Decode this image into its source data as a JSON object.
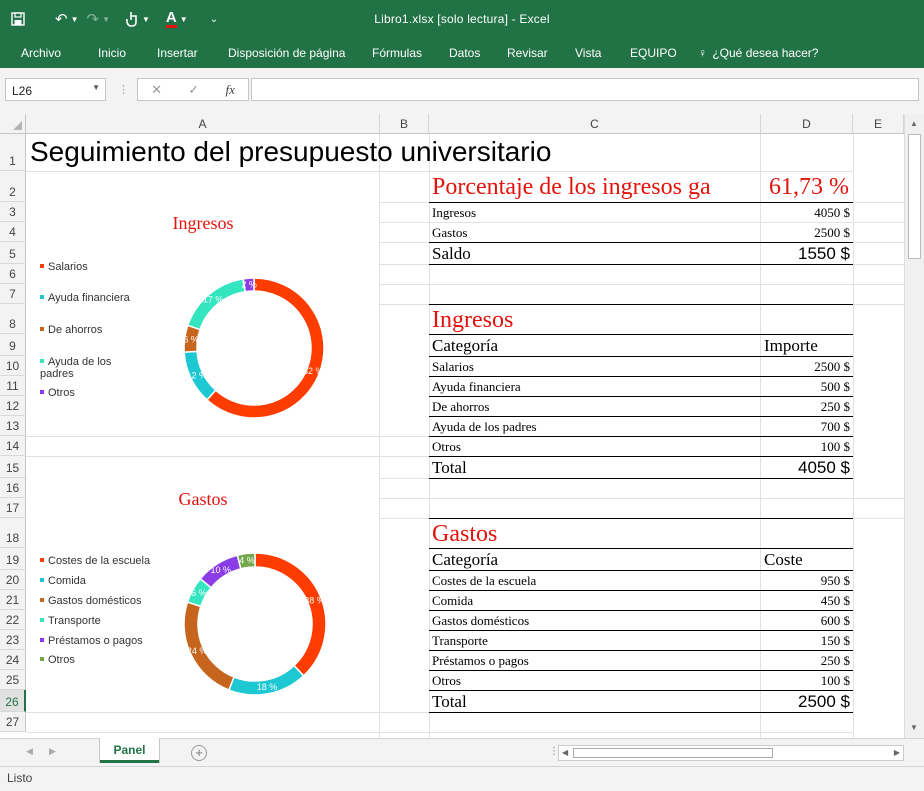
{
  "window": {
    "title": "Libro1.xlsx [solo lectura] - Excel"
  },
  "ribbon": {
    "tabs": [
      "Archivo",
      "Inicio",
      "Insertar",
      "Disposición de página",
      "Fórmulas",
      "Datos",
      "Revisar",
      "Vista",
      "EQUIPO",
      "¿Qué desea hacer?"
    ]
  },
  "formula_bar": {
    "name_box": "L26",
    "fx_label": "fx",
    "formula": ""
  },
  "grid": {
    "columns": [
      "A",
      "B",
      "C",
      "D",
      "E"
    ],
    "rows": [
      "1",
      "2",
      "3",
      "4",
      "5",
      "6",
      "7",
      "8",
      "9",
      "10",
      "11",
      "12",
      "13",
      "14",
      "15",
      "16",
      "17",
      "18",
      "19",
      "20",
      "21",
      "22",
      "23",
      "24",
      "25",
      "26",
      "27"
    ],
    "selected_row": "26"
  },
  "sheet": {
    "title": "Seguimiento del presupuesto universitario",
    "summary": {
      "pct_label": "Porcentaje de los ingresos ga",
      "pct_value": "61,73 %",
      "rows": [
        {
          "label": "Ingresos",
          "value": "4050 $"
        },
        {
          "label": "Gastos",
          "value": "2500 $"
        }
      ],
      "saldo_label": "Saldo",
      "saldo_value": "1550 $"
    },
    "ingresos": {
      "heading": "Ingresos",
      "col_category": "Categoría",
      "col_amount": "Importe",
      "rows": [
        {
          "label": "Salarios",
          "value": "2500 $"
        },
        {
          "label": "Ayuda financiera",
          "value": "500 $"
        },
        {
          "label": "De ahorros",
          "value": "250 $"
        },
        {
          "label": "Ayuda de los padres",
          "value": "700 $"
        },
        {
          "label": "Otros",
          "value": "100 $"
        }
      ],
      "total_label": "Total",
      "total_value": "4050 $"
    },
    "gastos": {
      "heading": "Gastos",
      "col_category": "Categoría",
      "col_amount": "Coste",
      "rows": [
        {
          "label": "Costes de la escuela",
          "value": "950 $"
        },
        {
          "label": "Comida",
          "value": "450 $"
        },
        {
          "label": "Gastos domésticos",
          "value": "600 $"
        },
        {
          "label": "Transporte",
          "value": "150 $"
        },
        {
          "label": "Préstamos o pagos",
          "value": "250 $"
        },
        {
          "label": "Otros",
          "value": "100 $"
        }
      ],
      "total_label": "Total",
      "total_value": "2500 $"
    }
  },
  "chart_data": [
    {
      "type": "pie",
      "title": "Ingresos",
      "categories": [
        "Salarios",
        "Ayuda financiera",
        "De ahorros",
        "Ayuda de los padres",
        "Otros"
      ],
      "values": [
        2500,
        500,
        250,
        700,
        100
      ],
      "labels": [
        "62 %",
        "12 %",
        "6 %",
        "17 %",
        "2 %"
      ],
      "colors": [
        "#ff3c00",
        "#1ec8d2",
        "#c6661e",
        "#33e6c0",
        "#8a3ce6"
      ],
      "donut": true,
      "legend": "left"
    },
    {
      "type": "pie",
      "title": "Gastos",
      "categories": [
        "Costes de la escuela",
        "Comida",
        "Gastos domésticos",
        "Transporte",
        "Préstamos o pagos",
        "Otros"
      ],
      "values": [
        950,
        450,
        600,
        150,
        250,
        100
      ],
      "labels": [
        "38 %",
        "18 %",
        "24 %",
        "6 %",
        "10 %",
        "4 %"
      ],
      "colors": [
        "#ff3c00",
        "#1ec8d2",
        "#c6661e",
        "#33e6c0",
        "#8a3ce6",
        "#72a84a"
      ],
      "donut": true,
      "legend": "left"
    }
  ],
  "sheet_tabs": {
    "active": "Panel"
  },
  "status": {
    "text": "Listo"
  }
}
